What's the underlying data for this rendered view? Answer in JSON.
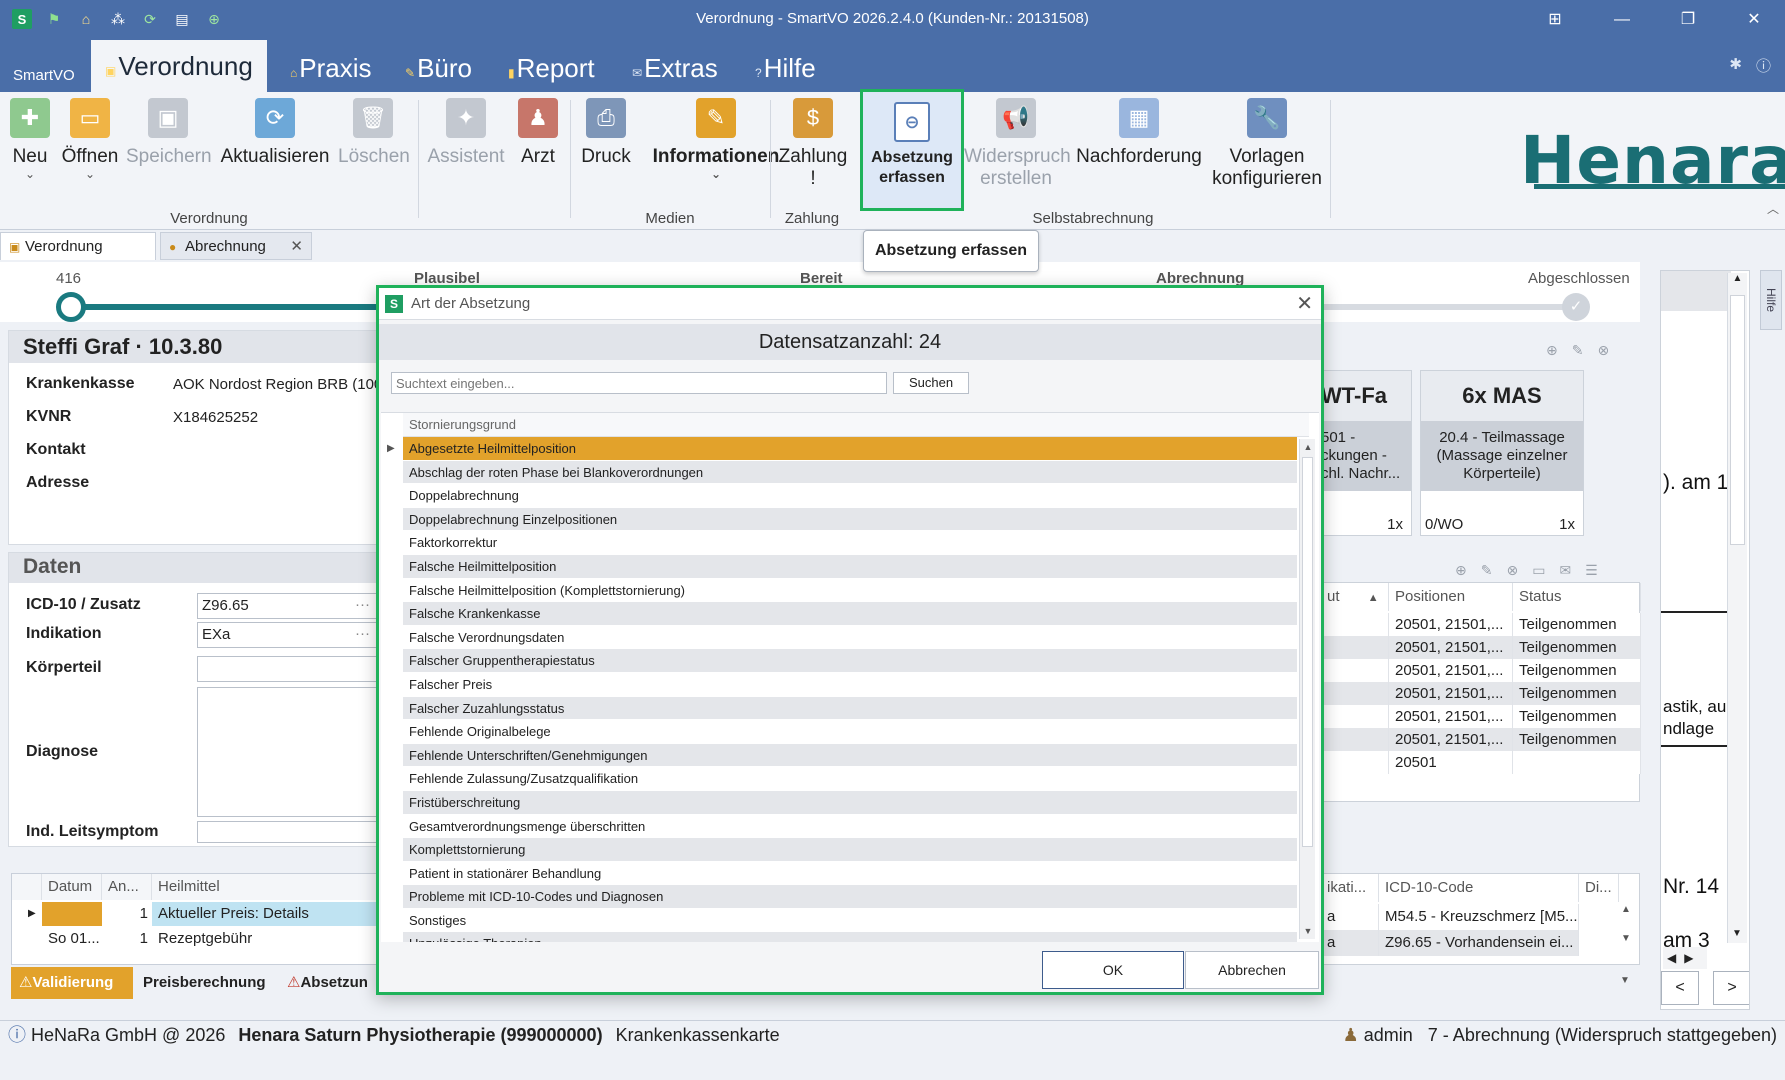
{
  "window": {
    "title": "Verordnung - SmartVO 2026.2.4.0 (Kunden-Nr.: 20131508)",
    "app_logo": "S",
    "controls": {
      "layout": "⊞",
      "minimize": "—",
      "restore": "❐",
      "close": "✕"
    }
  },
  "quick_access": [
    "flag-icon",
    "home-icon",
    "network-icon",
    "refresh-icon",
    "calendar-icon",
    "add-icon"
  ],
  "menu": {
    "app": "SmartVO",
    "items": [
      {
        "label": "Verordnung",
        "active": true
      },
      {
        "label": "Praxis"
      },
      {
        "label": "Büro"
      },
      {
        "label": "Report"
      },
      {
        "label": "Extras"
      },
      {
        "label": "Hilfe"
      }
    ]
  },
  "ribbon": {
    "groups": {
      "verordnung": "Verordnung",
      "medien": "Medien",
      "zahlung": "Zahlung",
      "selbstabrechnung": "Selbstabrechnung"
    },
    "buttons": {
      "neu": "Neu",
      "oeffnen": "Öffnen",
      "speichern": "Speichern",
      "aktualisieren": "Aktualisieren",
      "loeschen": "Löschen",
      "assistent": "Assistent",
      "arzt": "Arzt",
      "druck": "Druck",
      "informationen": "Informationen",
      "zahlung_1": "Zahlung",
      "zahlung_2": "!",
      "absetzung_1": "Absetzung",
      "absetzung_2": "erfassen",
      "widerspruch_1": "Widerspruch",
      "widerspruch_2": "erstellen",
      "nachforderung": "Nachforderung",
      "vorlagen_1": "Vorlagen",
      "vorlagen_2": "konfigurieren"
    },
    "brand": "Henara"
  },
  "tooltip": "Absetzung erfassen",
  "doc_tabs": {
    "tab1": "Verordnung",
    "tab2": "Abrechnung"
  },
  "progress": {
    "number": "416",
    "stages": [
      "Plausibel",
      "Bereit",
      "Abrechnung",
      "Abgeschlossen"
    ],
    "fill_fraction": 0.76
  },
  "patient": {
    "name": "Steffi Graf · 10.3.80",
    "labels": {
      "krankenkasse": "Krankenkasse",
      "kvnr": "KVNR",
      "kontakt": "Kontakt",
      "adresse": "Adresse"
    },
    "krankenkasse": "AOK Nordost Region BRB (100",
    "kvnr": "X184625252"
  },
  "daten": {
    "title": "Daten",
    "labels": {
      "icd": "ICD-10 / Zusatz",
      "indikation": "Indikation",
      "koerperteil": "Körperteil",
      "diagnose": "Diagnose",
      "leitsymptom": "Ind. Leitsymptom"
    },
    "icd": "Z96.65",
    "indikation": "EXa",
    "dots": "···"
  },
  "heilmittel_table": {
    "headers": [
      "Datum",
      "An...",
      "Heilmittel"
    ],
    "rows": [
      {
        "datum": "",
        "anzahl": "1",
        "heilmittel": "Aktueller Preis: Details"
      },
      {
        "datum": "So 01...",
        "anzahl": "1",
        "heilmittel": "Rezeptgebühr"
      }
    ]
  },
  "bottom_tabs": {
    "validierung": "Validierung",
    "preisberechnung": "Preisberechnung",
    "absetzung": "Absetzun"
  },
  "cards": [
    {
      "title": "WT-Fa",
      "body": "501 - ckungen - chl. Nachr...",
      "foot_left": "",
      "foot_right": "1x"
    },
    {
      "title": "6x MAS",
      "body": "20.4 - Teilmassage (Massage einzelner Körperteile)",
      "foot_left": "0/WO",
      "foot_right": "1x"
    }
  ],
  "positions_table": {
    "headers": [
      "ut",
      "Positionen",
      "Status"
    ],
    "rows": [
      {
        "positionen": "20501, 21501,...",
        "status": "Teilgenommen"
      },
      {
        "positionen": "20501, 21501,...",
        "status": "Teilgenommen"
      },
      {
        "positionen": "20501, 21501,...",
        "status": "Teilgenommen"
      },
      {
        "positionen": "20501, 21501,...",
        "status": "Teilgenommen"
      },
      {
        "positionen": "20501, 21501,...",
        "status": "Teilgenommen"
      },
      {
        "positionen": "20501, 21501,...",
        "status": "Teilgenommen"
      },
      {
        "positionen": "20501",
        "status": ""
      }
    ]
  },
  "icd_table": {
    "headers": [
      "ikati...",
      "ICD-10-Code",
      "Di..."
    ],
    "rows": [
      {
        "a": "a",
        "code": "M54.5 - Kreuzschmerz [M5..."
      },
      {
        "a": "a",
        "code": "Z96.65 - Vorhandensein ei..."
      }
    ]
  },
  "preview": {
    "l1": "). am 1",
    "l2": "astik, au",
    "l3": "ndlage",
    "l4": "Nr. 14",
    "l5": "am 3"
  },
  "help_side": "Hilfe",
  "statusbar": {
    "company": "HeNaRa GmbH @ 2026",
    "practice": "Henara Saturn Physiotherapie (999000000)",
    "card": "Krankenkassenkarte",
    "user": "admin",
    "state": "7 - Abrechnung (Widerspruch stattgegeben)"
  },
  "dialog": {
    "title": "Art der Absetzung",
    "count": "Datensatzanzahl: 24",
    "search_placeholder": "Suchtext eingeben...",
    "search_button": "Suchen",
    "column": "Stornierungsgrund",
    "rows": [
      "Abgesetzte Heilmittelposition",
      "Abschlag der roten Phase bei Blankoverordnungen",
      "Doppelabrechnung",
      "Doppelabrechnung Einzelpositionen",
      "Faktorkorrektur",
      "Falsche Heilmittelposition",
      "Falsche Heilmittelposition (Komplettstornierung)",
      "Falsche Krankenkasse",
      "Falsche Verordnungsdaten",
      "Falscher Gruppentherapiestatus",
      "Falscher Preis",
      "Falscher Zuzahlungsstatus",
      "Fehlende Originalbelege",
      "Fehlende Unterschriften/Genehmigungen",
      "Fehlende Zulassung/Zusatzqualifikation",
      "Fristüberschreitung",
      "Gesamtverordnungsmenge überschritten",
      "Komplettstornierung",
      "Patient in stationärer Behandlung",
      "Probleme mit ICD-10-Codes und Diagnosen",
      "Sonstiges",
      "Unzulässige Therapien"
    ],
    "ok": "OK",
    "cancel": "Abbrechen"
  },
  "colors": {
    "titlebar": "#4a6ea8",
    "accent_green": "#1fb25a",
    "selection": "#e2a22b",
    "brand": "#1a6e74"
  }
}
